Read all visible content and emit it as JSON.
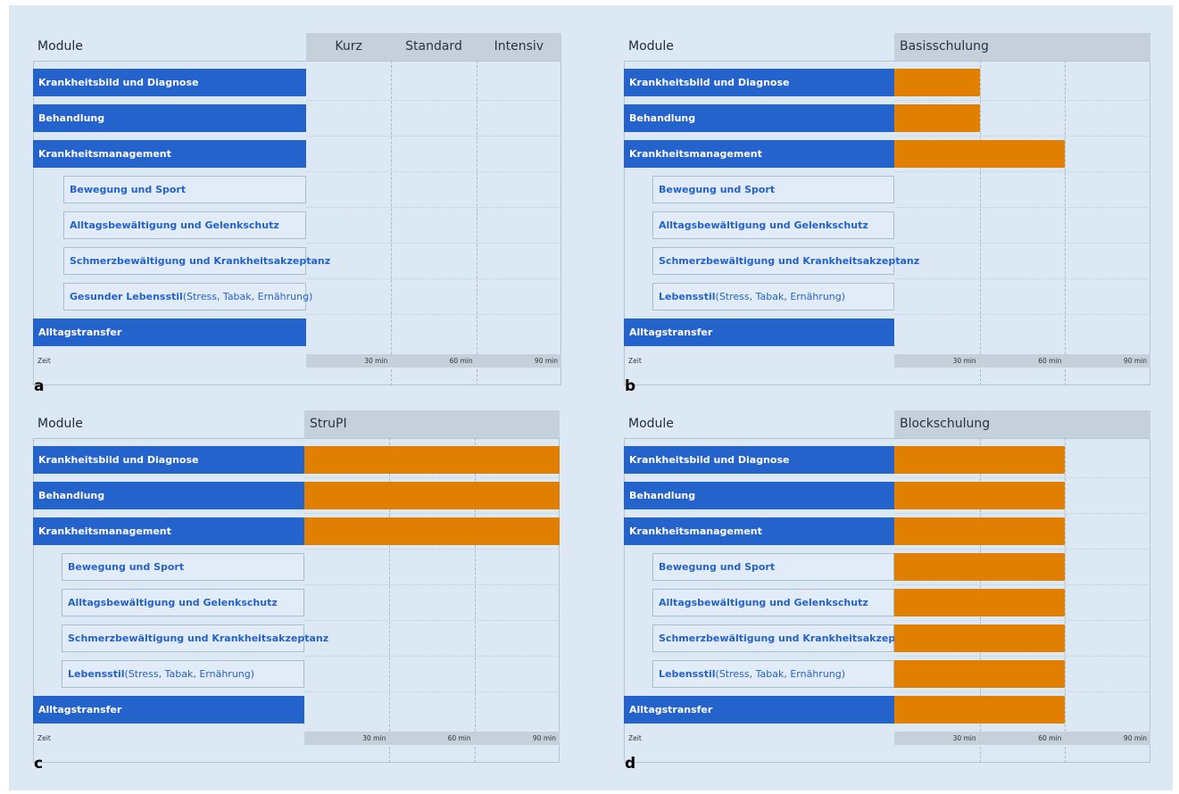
{
  "colors": {
    "background": "#dde8f5",
    "module_bar": "#2462cc",
    "submodule_bar": "#e2ecf8",
    "duration_bar": "#e07f00",
    "header": "#c5d0da"
  },
  "chart_data": [
    {
      "type": "bar",
      "panel_label": "a",
      "module_header": "Module",
      "column_headers": [
        "Kurz",
        "Standard",
        "Intensiv"
      ],
      "time_label": "Zeit",
      "ticks": [
        "30 min",
        "60 min",
        "90 min"
      ],
      "xlim": [
        0,
        90
      ],
      "rows": [
        {
          "kind": "main",
          "label": "Krankheitsbild und Diagnose",
          "suffix": ""
        },
        {
          "kind": "main",
          "label": "Behandlung",
          "suffix": ""
        },
        {
          "kind": "main",
          "label": "Krankheitsmanagement",
          "suffix": ""
        },
        {
          "kind": "sub",
          "label": "Bewegung und Sport",
          "suffix": ""
        },
        {
          "kind": "sub",
          "label": "Alltagsbewältigung und Gelenkschutz",
          "suffix": ""
        },
        {
          "kind": "sub",
          "label": "Schmerzbewältigung und Krankheitsakzeptanz",
          "suffix": ""
        },
        {
          "kind": "sub",
          "label": "Gesunder Lebensstil",
          "suffix": " (Stress, Tabak, Ernährung)"
        },
        {
          "kind": "main",
          "label": "Alltagstransfer",
          "suffix": ""
        }
      ],
      "values": [
        0,
        0,
        0,
        0,
        0,
        0,
        0,
        0
      ]
    },
    {
      "type": "bar",
      "panel_label": "b",
      "module_header": "Module",
      "column_headers": [
        "Basisschulung"
      ],
      "time_label": "Zeit",
      "ticks": [
        "30 min",
        "60 min",
        "90 min"
      ],
      "xlim": [
        0,
        90
      ],
      "rows": [
        {
          "kind": "main",
          "label": "Krankheitsbild und Diagnose",
          "suffix": ""
        },
        {
          "kind": "main",
          "label": "Behandlung",
          "suffix": ""
        },
        {
          "kind": "main",
          "label": "Krankheitsmanagement",
          "suffix": ""
        },
        {
          "kind": "sub",
          "label": "Bewegung und Sport",
          "suffix": ""
        },
        {
          "kind": "sub",
          "label": "Alltagsbewältigung und Gelenkschutz",
          "suffix": ""
        },
        {
          "kind": "sub",
          "label": "Schmerzbewältigung und Krankheitsakzeptanz",
          "suffix": ""
        },
        {
          "kind": "sub",
          "label": "Lebensstil",
          "suffix": " (Stress, Tabak, Ernährung)"
        },
        {
          "kind": "main",
          "label": "Alltagstransfer",
          "suffix": ""
        }
      ],
      "values": [
        30,
        30,
        60,
        0,
        0,
        0,
        0,
        0
      ]
    },
    {
      "type": "bar",
      "panel_label": "c",
      "module_header": "Module",
      "column_headers": [
        "StruPI"
      ],
      "time_label": "Zeit",
      "ticks": [
        "30 min",
        "60 min",
        "90 min"
      ],
      "xlim": [
        0,
        90
      ],
      "rows": [
        {
          "kind": "main",
          "label": "Krankheitsbild und Diagnose",
          "suffix": ""
        },
        {
          "kind": "main",
          "label": "Behandlung",
          "suffix": ""
        },
        {
          "kind": "main",
          "label": "Krankheitsmanagement",
          "suffix": ""
        },
        {
          "kind": "sub",
          "label": "Bewegung und Sport",
          "suffix": ""
        },
        {
          "kind": "sub",
          "label": "Alltagsbewältigung und Gelenkschutz",
          "suffix": ""
        },
        {
          "kind": "sub",
          "label": "Schmerzbewältigung und Krankheitsakzeptanz",
          "suffix": ""
        },
        {
          "kind": "sub",
          "label": "Lebensstil",
          "suffix": " (Stress, Tabak, Ernährung)"
        },
        {
          "kind": "main",
          "label": "Alltagstransfer",
          "suffix": ""
        }
      ],
      "values": [
        90,
        90,
        90,
        0,
        0,
        0,
        0,
        0
      ]
    },
    {
      "type": "bar",
      "panel_label": "d",
      "module_header": "Module",
      "column_headers": [
        "Blockschulung"
      ],
      "time_label": "Zeit",
      "ticks": [
        "30 min",
        "60 min",
        "90 min"
      ],
      "xlim": [
        0,
        90
      ],
      "rows": [
        {
          "kind": "main",
          "label": "Krankheitsbild und Diagnose",
          "suffix": ""
        },
        {
          "kind": "main",
          "label": "Behandlung",
          "suffix": ""
        },
        {
          "kind": "main",
          "label": "Krankheitsmanagement",
          "suffix": ""
        },
        {
          "kind": "sub",
          "label": "Bewegung und Sport",
          "suffix": ""
        },
        {
          "kind": "sub",
          "label": "Alltagsbewältigung und Gelenkschutz",
          "suffix": ""
        },
        {
          "kind": "sub",
          "label": "Schmerzbewältigung und Krankheitsakzeptanz",
          "suffix": ""
        },
        {
          "kind": "sub",
          "label": "Lebensstil",
          "suffix": " (Stress, Tabak, Ernährung)"
        },
        {
          "kind": "main",
          "label": "Alltagstransfer",
          "suffix": ""
        }
      ],
      "values": [
        60,
        60,
        60,
        60,
        60,
        60,
        60,
        60
      ]
    }
  ]
}
